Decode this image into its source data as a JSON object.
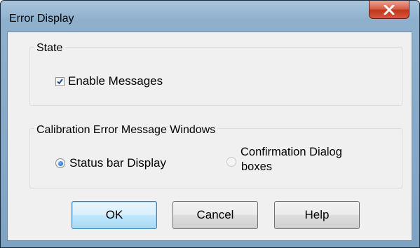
{
  "window": {
    "title": "Error Display"
  },
  "state_group": {
    "label": "State",
    "enable_messages": {
      "label": "Enable Messages",
      "checked": true
    }
  },
  "calibration_group": {
    "label": "Calibration Error Message Windows",
    "options": [
      {
        "label": "Status bar Display",
        "selected": true
      },
      {
        "label_line1": "Confirmation Dialog",
        "label_line2": "boxes",
        "selected": false
      }
    ]
  },
  "buttons": {
    "ok": "OK",
    "cancel": "Cancel",
    "help": "Help"
  },
  "icons": {
    "close": "close-icon",
    "checkmark": "checkmark-icon"
  },
  "colors": {
    "titlebar": "#8fb0cc",
    "close_button": "#c7432a",
    "dialog_bg": "#f0f0f0",
    "default_button_border": "#3c7fb1",
    "radio_selected": "#1e5fbf"
  }
}
